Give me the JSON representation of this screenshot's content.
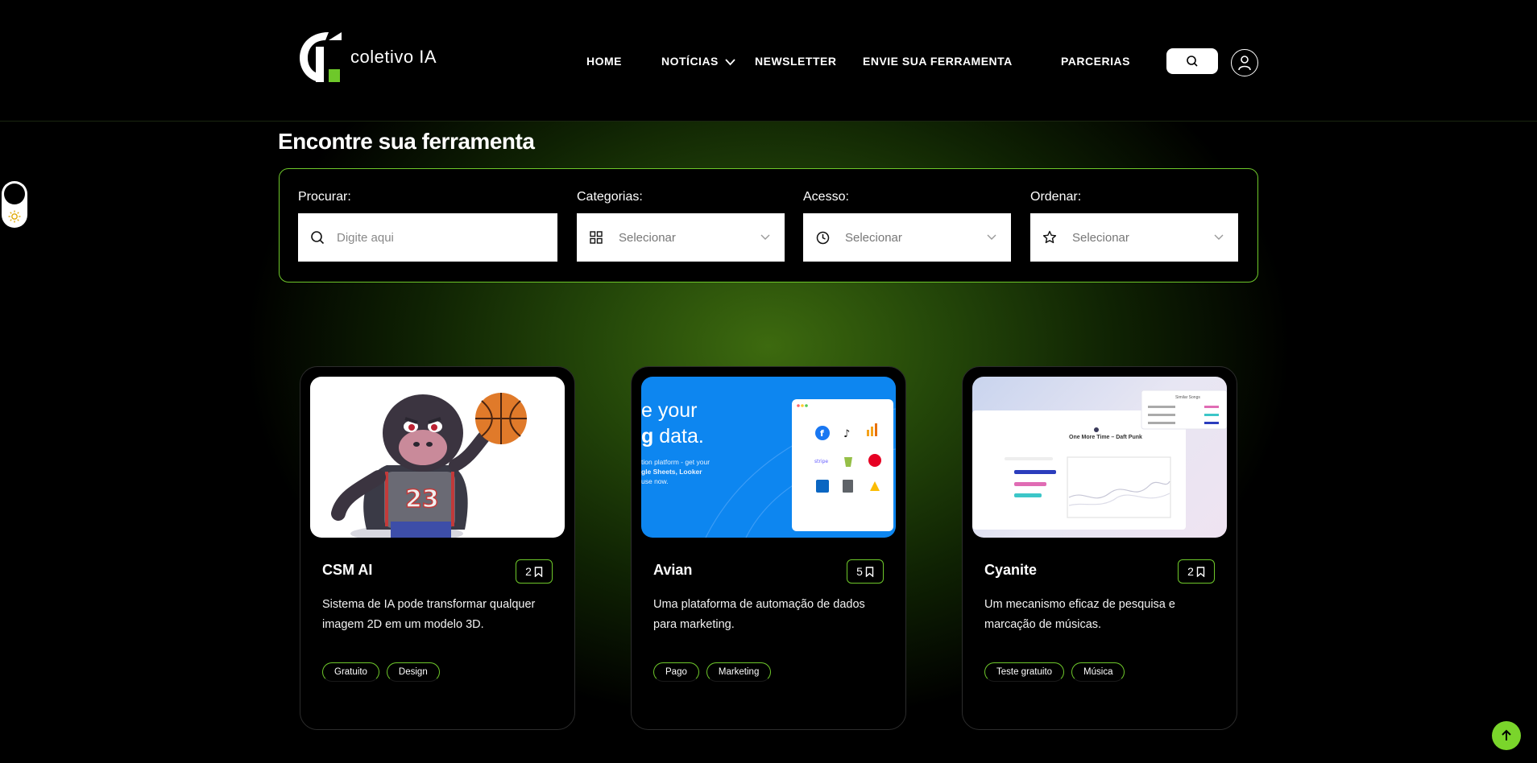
{
  "brand": {
    "logo_text": "coletivo IA",
    "accent_color": "#6ec82a"
  },
  "nav": {
    "home": "HOME",
    "noticias": "NOTÍCIAS",
    "newsletter": "NEWSLETTER",
    "envie": "ENVIE SUA FERRAMENTA",
    "parcerias": "PARCERIAS"
  },
  "icons": {
    "search": "search-icon",
    "user": "user-icon",
    "theme": "sun-icon",
    "scroll_top": "arrow-up-icon"
  },
  "section": {
    "title": "Encontre sua ferramenta"
  },
  "filters": {
    "procurar": {
      "label": "Procurar:",
      "placeholder": "Digite aqui"
    },
    "categorias": {
      "label": "Categorias:",
      "value": "Selecionar"
    },
    "acesso": {
      "label": "Acesso:",
      "value": "Selecionar"
    },
    "ordenar": {
      "label": "Ordenar:",
      "value": "Selecionar"
    }
  },
  "cards": [
    {
      "name": "CSM AI",
      "count": "2",
      "description": "Sistema de IA pode transformar qualquer imagem 2D em um modelo 3D.",
      "tags": [
        "Gratuito",
        "Design"
      ]
    },
    {
      "name": "Avian",
      "count": "5",
      "description": "Uma plataforma de automação de dados para marketing.",
      "tags": [
        "Pago",
        "Marketing"
      ],
      "thumb_text": {
        "line1": "e your",
        "line2a": "g",
        "line2b": " data.",
        "small1": "tion platform - get your",
        "small2": "gle Sheets, Looker",
        "small3": "use now."
      }
    },
    {
      "name": "Cyanite",
      "count": "2",
      "description": "Um mecanismo eficaz de pesquisa e marcação de músicas.",
      "tags": [
        "Teste gratuito",
        "Música"
      ],
      "thumb_text": {
        "song": "One More Time – Daft Punk",
        "similar": "Similar Songs"
      }
    }
  ]
}
